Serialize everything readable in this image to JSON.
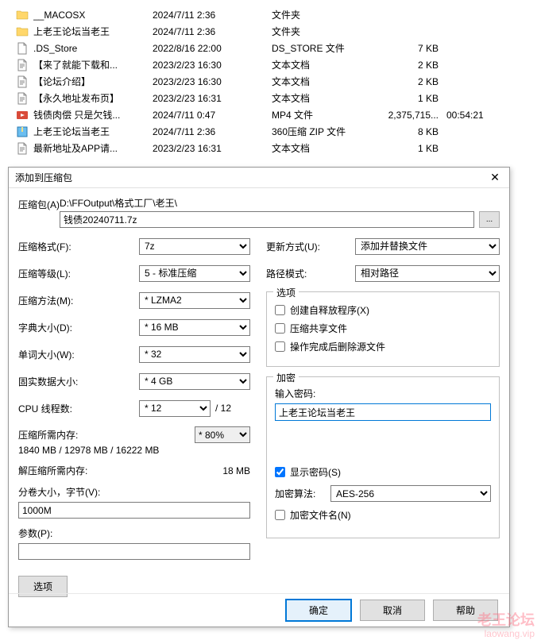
{
  "files": [
    {
      "icon": "folder",
      "name": "__MACOSX",
      "date": "2024/7/11 2:36",
      "type": "文件夹",
      "size": "",
      "dur": ""
    },
    {
      "icon": "folder",
      "name": "上老王论坛当老王",
      "date": "2024/7/11 2:36",
      "type": "文件夹",
      "size": "",
      "dur": ""
    },
    {
      "icon": "file",
      "name": ".DS_Store",
      "date": "2022/8/16 22:00",
      "type": "DS_STORE 文件",
      "size": "7 KB",
      "dur": ""
    },
    {
      "icon": "txt",
      "name": "【来了就能下载和...",
      "date": "2023/2/23 16:30",
      "type": "文本文档",
      "size": "2 KB",
      "dur": ""
    },
    {
      "icon": "txt",
      "name": "【论坛介绍】",
      "date": "2023/2/23 16:30",
      "type": "文本文档",
      "size": "2 KB",
      "dur": ""
    },
    {
      "icon": "txt",
      "name": "【永久地址发布页】",
      "date": "2023/2/23 16:31",
      "type": "文本文档",
      "size": "1 KB",
      "dur": ""
    },
    {
      "icon": "mp4",
      "name": "钱债肉偿 只是欠钱...",
      "date": "2024/7/11 0:47",
      "type": "MP4 文件",
      "size": "2,375,715...",
      "dur": "00:54:21"
    },
    {
      "icon": "zip",
      "name": "上老王论坛当老王",
      "date": "2024/7/11 2:36",
      "type": "360压缩 ZIP 文件",
      "size": "8 KB",
      "dur": ""
    },
    {
      "icon": "txt",
      "name": "最新地址及APP请...",
      "date": "2023/2/23 16:31",
      "type": "文本文档",
      "size": "1 KB",
      "dur": ""
    }
  ],
  "dialog": {
    "title": "添加到压缩包",
    "archive_label": "压缩包(A)",
    "archive_path": "D:\\FFOutput\\格式工厂\\老王\\",
    "archive_file": "钱债20240711.7z",
    "browse": "...",
    "left": {
      "format_label": "压缩格式(F):",
      "format_value": "7z",
      "level_label": "压缩等级(L):",
      "level_value": "5 - 标准压缩",
      "method_label": "压缩方法(M):",
      "method_value": "* LZMA2",
      "dict_label": "字典大小(D):",
      "dict_value": "* 16 MB",
      "word_label": "单词大小(W):",
      "word_value": "* 32",
      "solid_label": "固实数据大小:",
      "solid_value": "* 4 GB",
      "cpu_label": "CPU 线程数:",
      "cpu_value": "* 12",
      "cpu_suffix": "/ 12",
      "mem_comp_label": "压缩所需内存:",
      "mem_comp_select": "* 80%",
      "mem_comp_value": "1840 MB / 12978 MB / 16222 MB",
      "mem_decomp_label": "解压缩所需内存:",
      "mem_decomp_value": "18 MB",
      "split_label": "分卷大小，字节(V):",
      "split_value": "1000M",
      "params_label": "参数(P):",
      "params_value": "",
      "options_btn": "选项"
    },
    "right": {
      "update_label": "更新方式(U):",
      "update_value": "添加并替换文件",
      "path_label": "路径模式:",
      "path_value": "相对路径",
      "options_group": "选项",
      "sfx_label": "创建自释放程序(X)",
      "shared_label": "压缩共享文件",
      "delete_label": "操作完成后删除源文件",
      "encrypt_group": "加密",
      "pwd_label": "输入密码:",
      "pwd_value": "上老王论坛当老王",
      "show_pwd_label": "显示密码(S)",
      "enc_label": "加密算法:",
      "enc_value": "AES-256",
      "enc_names_label": "加密文件名(N)"
    },
    "ok": "确定",
    "cancel": "取消",
    "help": "帮助"
  },
  "watermark": {
    "line1": "老王论坛",
    "line2": "laowang.vip"
  }
}
